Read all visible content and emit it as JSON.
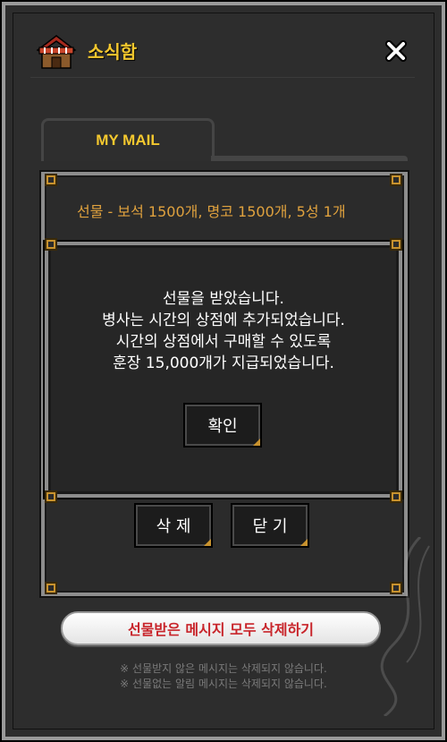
{
  "header": {
    "title": "소식함",
    "icon": "shop-house-icon",
    "close_icon": "close-icon"
  },
  "tabs": [
    {
      "label": "MY MAIL",
      "active": true
    }
  ],
  "mail_list": {
    "items": [
      {
        "text": "선물 - 보석 1500개, 명코 1500개, 5성 1개"
      }
    ],
    "delete_label": "삭 제",
    "close_label": "닫 기"
  },
  "popup": {
    "lines": [
      "선물을 받았습니다.",
      "병사는 시간의 상점에 추가되었습니다.",
      "시간의 상점에서 구매할 수 있도록",
      "훈장 15,000개가 지급되었습니다."
    ],
    "confirm_label": "확인"
  },
  "footer": {
    "delete_all_label": "선물받은 메시지 모두 삭제하기",
    "notices": [
      "※ 선물받지 않은 메시지는 삭제되지 않습니다.",
      "※ 선물없는 알림 메시지는 삭제되지 않습니다."
    ]
  },
  "colors": {
    "accent_yellow": "#f4c82e",
    "mail_orange": "#e0a23e",
    "delete_red": "#c8242a",
    "bracket_gold": "#c8922e"
  }
}
